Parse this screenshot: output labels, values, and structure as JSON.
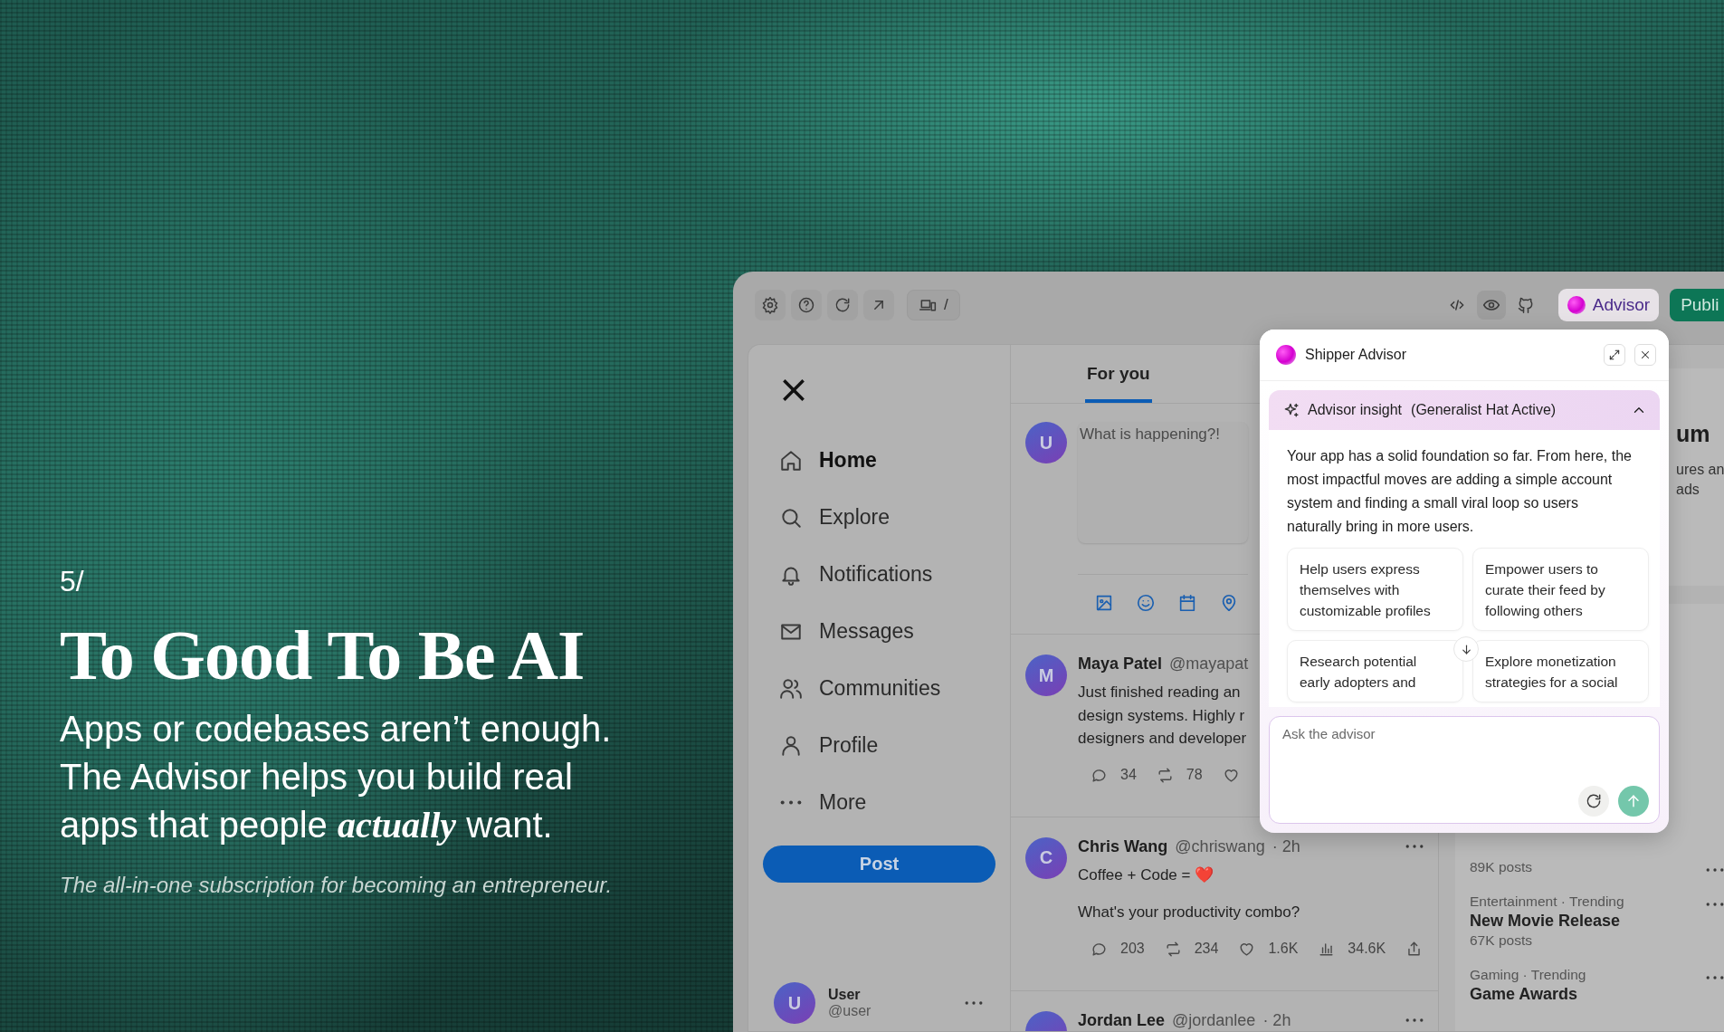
{
  "slide": {
    "step": "5/",
    "title": "To Good To Be AI",
    "lede_lines": [
      "Apps or codebases aren’t enough.",
      "The Advisor helps you build real",
      "apps that people *actually* want."
    ],
    "tagline": "The all-in-one subscription for becoming an entrepreneur."
  },
  "toolbar": {
    "left_buttons": [
      {
        "kind": "gear"
      },
      {
        "kind": "help"
      },
      {
        "kind": "refresh"
      },
      {
        "kind": "external"
      }
    ],
    "route": "/",
    "right_buttons": [
      {
        "kind": "code",
        "selected": false
      },
      {
        "kind": "preview",
        "selected": true
      },
      {
        "kind": "repository",
        "selected": false
      }
    ],
    "advisor_button": "Advisor",
    "publish_button": "Publi"
  },
  "nav": {
    "items": [
      {
        "kind": "home",
        "label": "Home",
        "selected": true
      },
      {
        "kind": "search",
        "label": "Explore",
        "selected": false
      },
      {
        "kind": "bell",
        "label": "Notifications",
        "selected": false
      },
      {
        "kind": "mail",
        "label": "Messages",
        "selected": false
      },
      {
        "kind": "users",
        "label": "Communities",
        "selected": false
      },
      {
        "kind": "user",
        "label": "Profile",
        "selected": false
      },
      {
        "kind": "more",
        "label": "More",
        "selected": false
      }
    ],
    "post_button": "Post",
    "account": {
      "avatar": "U",
      "name": "User",
      "handle": "@user"
    }
  },
  "feed": {
    "tabs": [
      {
        "label": "For you",
        "selected": true
      }
    ],
    "composer": {
      "avatar": "U",
      "placeholder": "What is happening?!",
      "tools": [
        {
          "kind": "image"
        },
        {
          "kind": "smile"
        },
        {
          "kind": "calendar"
        },
        {
          "kind": "pin"
        }
      ]
    },
    "posts": [
      {
        "avatar": "M",
        "name": "Maya Patel",
        "handle": "@mayapat",
        "paragraphs": [
          [
            "Just finished reading an",
            "design systems. Highly r",
            "designers and developer"
          ]
        ],
        "stats": [
          {
            "kind": "reply",
            "count": "34"
          },
          {
            "kind": "repost",
            "count": "78"
          },
          {
            "kind": "heart"
          }
        ]
      },
      {
        "avatar": "C",
        "name": "Chris Wang",
        "handle": "@chriswang",
        "time": "· 2h",
        "menu": true,
        "paragraphs": [
          [
            "Coffee + Code = ❤️"
          ],
          [
            "What's your productivity combo?"
          ]
        ],
        "stats": [
          {
            "kind": "reply",
            "count": "203"
          },
          {
            "kind": "repost",
            "count": "234"
          },
          {
            "kind": "heart",
            "count": "1.6K"
          },
          {
            "kind": "chart",
            "count": "34.6K"
          },
          {
            "kind": "share"
          }
        ]
      },
      {
        "name": "Jordan Lee",
        "handle": "@jordanlee",
        "time": "· 2h",
        "menu": true
      }
    ]
  },
  "sidebar": {
    "card": {
      "heading": "um",
      "lines": [
        "ures an",
        "ads"
      ]
    },
    "trends": [
      {
        "posts": "89K posts"
      },
      {
        "category": "Entertainment · Trending",
        "title": "New Movie Release",
        "posts": "67K posts"
      },
      {
        "category": "Gaming · Trending",
        "title": "Game Awards"
      }
    ]
  },
  "advisor": {
    "title": "Shipper Advisor",
    "insight": {
      "label": "Advisor insight",
      "hat": "(Generalist Hat Active)",
      "expanded": true,
      "text": "Your app has a solid foundation so far. From here, the most impactful moves are adding a simple account system and finding a small viral loop so users naturally bring in more users.",
      "suggestions": [
        {
          "lines": [
            "Help users express",
            "themselves with",
            "customizable profiles"
          ]
        },
        {
          "lines": [
            "Empower users to",
            "curate their feed by",
            "following others"
          ]
        },
        {
          "lines": [
            "Research potential",
            "early adopters and"
          ]
        },
        {
          "lines": [
            "Explore monetization",
            "strategies for a social"
          ]
        }
      ]
    },
    "input": {
      "placeholder": "Ask the advisor"
    }
  }
}
